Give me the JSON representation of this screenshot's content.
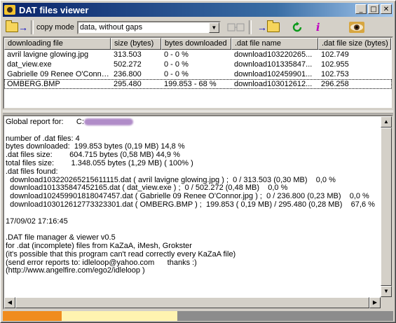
{
  "window": {
    "title": "DAT files viewer"
  },
  "toolbar": {
    "copy_mode_label": "copy mode",
    "copy_mode_value": "data, without gaps"
  },
  "table": {
    "headers": [
      "downloading file",
      "size (bytes)",
      "bytes downloaded",
      ".dat file name",
      ".dat file size (bytes)"
    ],
    "rows": [
      [
        "avril lavigne glowing.jpg",
        "313.503",
        "0 - 0 %",
        "download103220265...",
        "102.749"
      ],
      [
        "dat_view.exe",
        "502.272",
        "0 - 0 %",
        "download101335847...",
        "102.955"
      ],
      [
        "Gabrielle 09 Renee O'Conno...",
        "236.800",
        "0 - 0 %",
        "download102459901...",
        "102.753"
      ],
      [
        "OMBERG.BMP",
        "295.480",
        "199.853 - 68 %",
        "download103012612...",
        "296.258"
      ]
    ]
  },
  "report": {
    "global_label": "Global report for:",
    "drive": "C:",
    "lines": [
      "number of .dat files: 4",
      "bytes downloaded:  199.853 bytes (0,19 MB) 14,8 %",
      ".dat files size:        604.715 bytes (0,58 MB) 44,9 %",
      "total files size:        1.348.055 bytes (1,29 MB) ( 100% )",
      ".dat files found:",
      "  download103220265215611115.dat ( avril lavigne glowing.jpg ) ;  0 / 313.503 (0,30 MB)    0,0 %",
      "  download101335847452165.dat ( dat_view.exe ) ;  0 / 502.272 (0,48 MB)    0,0 %",
      "  download102459901818047457.dat ( Gabrielle 09 Renee O'Connor.jpg ) ;  0 / 236.800 (0,23 MB)    0,0 %",
      "  download103012612773323301.dat ( OMBERG.BMP ) ;  199.853 ( 0,19 MB) / 295.480 (0,28 MB)    67,6 %",
      "",
      "17/09/02 17:16:45",
      "",
      ".DAT file manager & viewer v0.5",
      "for .dat (incomplete) files from KaZaA, iMesh, Grokster",
      "(it's possible that this program can't read correctly every KaZaA file)",
      "(send error reports to: idleloop@yahoo.com      thanks :)",
      "(http://www.angelfire.com/ego2/idleloop )"
    ]
  },
  "colors": {
    "title_bar": "#0a246a",
    "status_orange": "#f08c1e",
    "status_yellow": "#fff3b0",
    "status_gray": "#8c8c8c"
  }
}
